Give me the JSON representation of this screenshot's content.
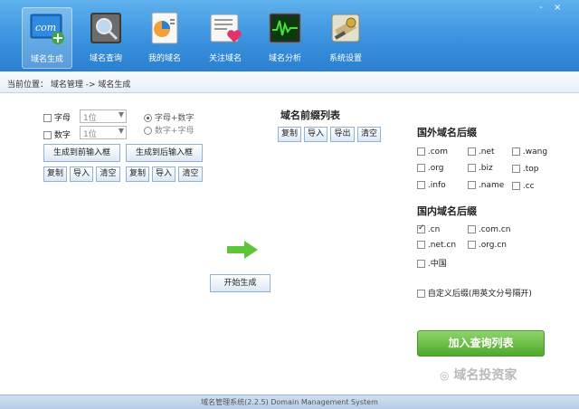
{
  "toolbar": {
    "items": [
      {
        "label": "域名生成",
        "icon": "domain-generate-icon",
        "active": true
      },
      {
        "label": "域名查询",
        "icon": "domain-search-icon"
      },
      {
        "label": "我的域名",
        "icon": "my-domains-icon"
      },
      {
        "label": "关注域名",
        "icon": "favorite-domains-icon"
      },
      {
        "label": "域名分析",
        "icon": "analysis-icon"
      },
      {
        "label": "系统设置",
        "icon": "settings-icon"
      }
    ],
    "com_text": "com",
    "window_controls": [
      "-",
      "×"
    ]
  },
  "breadcrumb": {
    "text": "当前位置： 域名管理 -> 域名生成"
  },
  "generator": {
    "row1": {
      "checkbox_label": "字母",
      "select_value": "1位"
    },
    "row2": {
      "checkbox_label": "数字",
      "select_value": "1位"
    },
    "radio1": "字母+数字",
    "radio2": "数字+字母",
    "btn_to_front": "生成到前输入框",
    "btn_to_back": "生成到后输入框",
    "left_actions": [
      "复制",
      "导入",
      "清空"
    ],
    "right_actions": [
      "复制",
      "导入",
      "清空"
    ]
  },
  "prefix_list": {
    "title": "域名前缀列表",
    "actions": [
      "复制",
      "导入",
      "导出",
      "清空"
    ]
  },
  "start_button": "开始生成",
  "foreign_suffix": {
    "title": "国外域名后缀",
    "items": [
      ".com",
      ".net",
      ".wang",
      ".org",
      ".biz",
      ".top",
      ".info",
      ".name",
      ".cc"
    ]
  },
  "domestic_suffix": {
    "title": "国内域名后缀",
    "items": [
      ".cn",
      ".com.cn",
      ".net.cn",
      ".org.cn",
      ".中国"
    ],
    "checked": [
      ".cn"
    ]
  },
  "custom_suffix_label": "自定义后缀(用英文分号隔开)",
  "add_button": "加入查询列表",
  "watermark": "域名投资家",
  "status_bar": "域名管理系统(2.2.5) Domain Management System",
  "colors": {
    "toolbar": "#3a93de",
    "green_button": "#5cb837",
    "arrow": "#5cc53a"
  }
}
